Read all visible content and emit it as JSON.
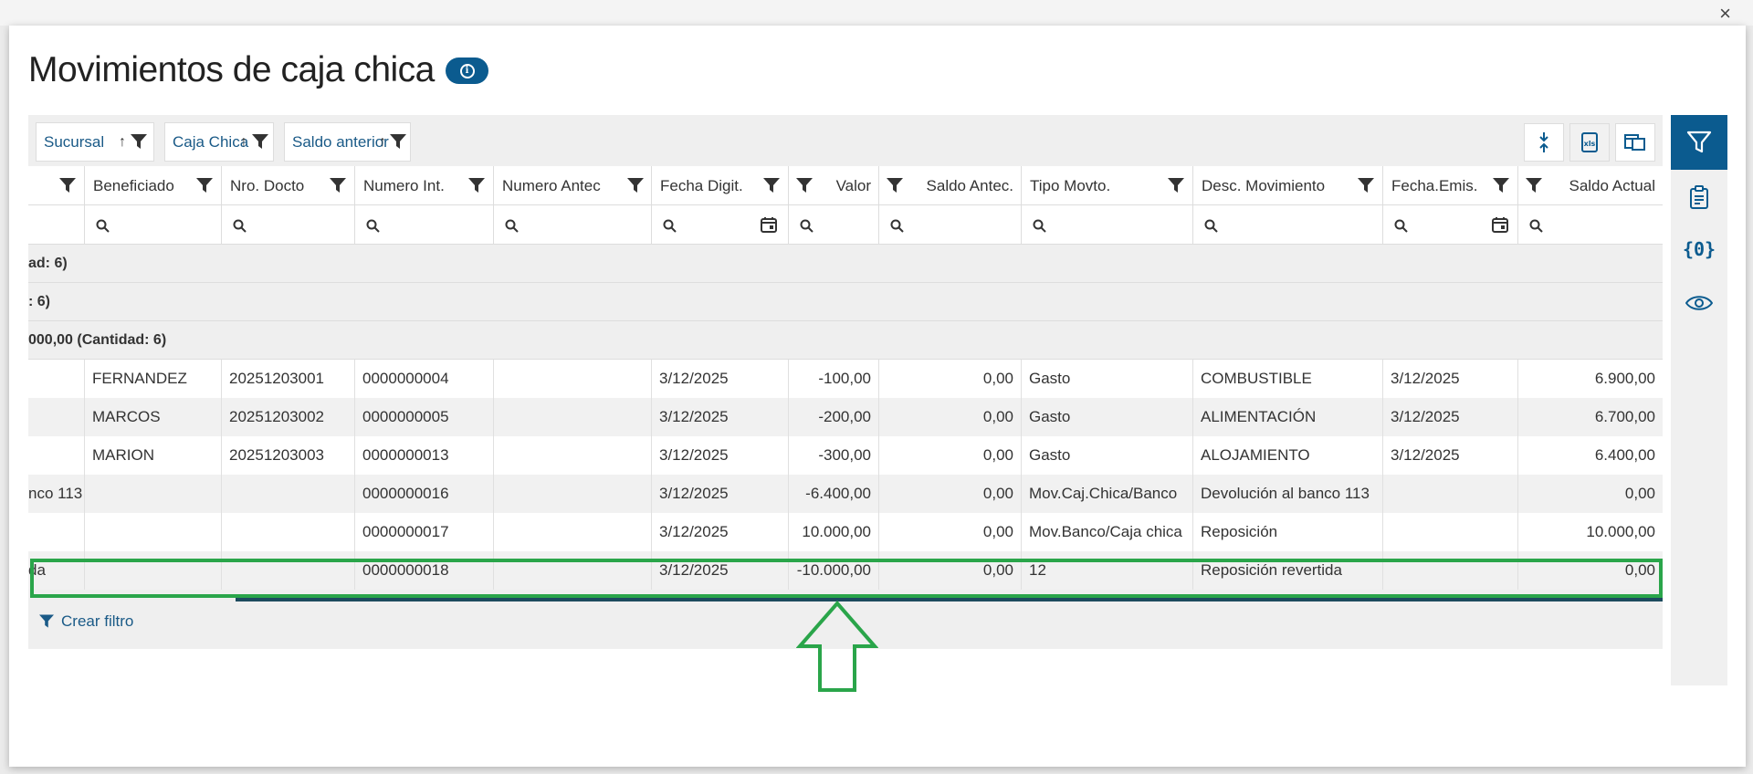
{
  "dialog": {
    "title": "Movimientos de caja chica",
    "close_label": "×"
  },
  "group_by": [
    {
      "label": "Sucursal"
    },
    {
      "label": "Caja Chica"
    },
    {
      "label": "Saldo anterior"
    }
  ],
  "columns": [
    {
      "label": ""
    },
    {
      "label": "Beneficiado"
    },
    {
      "label": "Nro. Docto"
    },
    {
      "label": "Numero Int."
    },
    {
      "label": "Numero Antec"
    },
    {
      "label": "Fecha Digit."
    },
    {
      "label": "Valor"
    },
    {
      "label": "Saldo Antec."
    },
    {
      "label": "Tipo Movto."
    },
    {
      "label": "Desc. Movimiento"
    },
    {
      "label": "Fecha.Emis."
    },
    {
      "label": "Saldo Actual"
    }
  ],
  "groups": [
    {
      "text": "ad: 6)"
    },
    {
      "text": ": 6)"
    },
    {
      "text": "000,00 (Cantidad: 6)"
    }
  ],
  "rows": [
    [
      "",
      "FERNANDEZ",
      "20251203001",
      "0000000004",
      "",
      "3/12/2025",
      "-100,00",
      "0,00",
      "Gasto",
      "COMBUSTIBLE",
      "3/12/2025",
      "6.900,00"
    ],
    [
      "",
      "MARCOS",
      "20251203002",
      "0000000005",
      "",
      "3/12/2025",
      "-200,00",
      "0,00",
      "Gasto",
      "ALIMENTACIÓN",
      "3/12/2025",
      "6.700,00"
    ],
    [
      "",
      "MARION",
      "20251203003",
      "0000000013",
      "",
      "3/12/2025",
      "-300,00",
      "0,00",
      "Gasto",
      "ALOJAMIENTO",
      "3/12/2025",
      "6.400,00"
    ],
    [
      "nco 113",
      "",
      "",
      "0000000016",
      "",
      "3/12/2025",
      "-6.400,00",
      "0,00",
      "Mov.Caj.Chica/Banco",
      "Devolución al banco 113",
      "",
      "0,00"
    ],
    [
      "",
      "",
      "",
      "0000000017",
      "",
      "3/12/2025",
      "10.000,00",
      "0,00",
      "Mov.Banco/Caja chica",
      "Reposición",
      "",
      "10.000,00"
    ],
    [
      "da",
      "",
      "",
      "0000000018",
      "",
      "3/12/2025",
      "-10.000,00",
      "0,00",
      "12",
      "Reposición revertida",
      "",
      "0,00"
    ]
  ],
  "footer": {
    "create_filter_label": "Crear filtro"
  },
  "side_icons": [
    "filter-icon",
    "clipboard-icon",
    "variables-icon",
    "eye-icon"
  ],
  "toolbar_icons": [
    "collapse-icon",
    "excel-export-icon",
    "column-chooser-icon"
  ],
  "colors": {
    "primary": "#0b5b8f",
    "link": "#1a5a87",
    "highlight": "#2aa54a"
  }
}
